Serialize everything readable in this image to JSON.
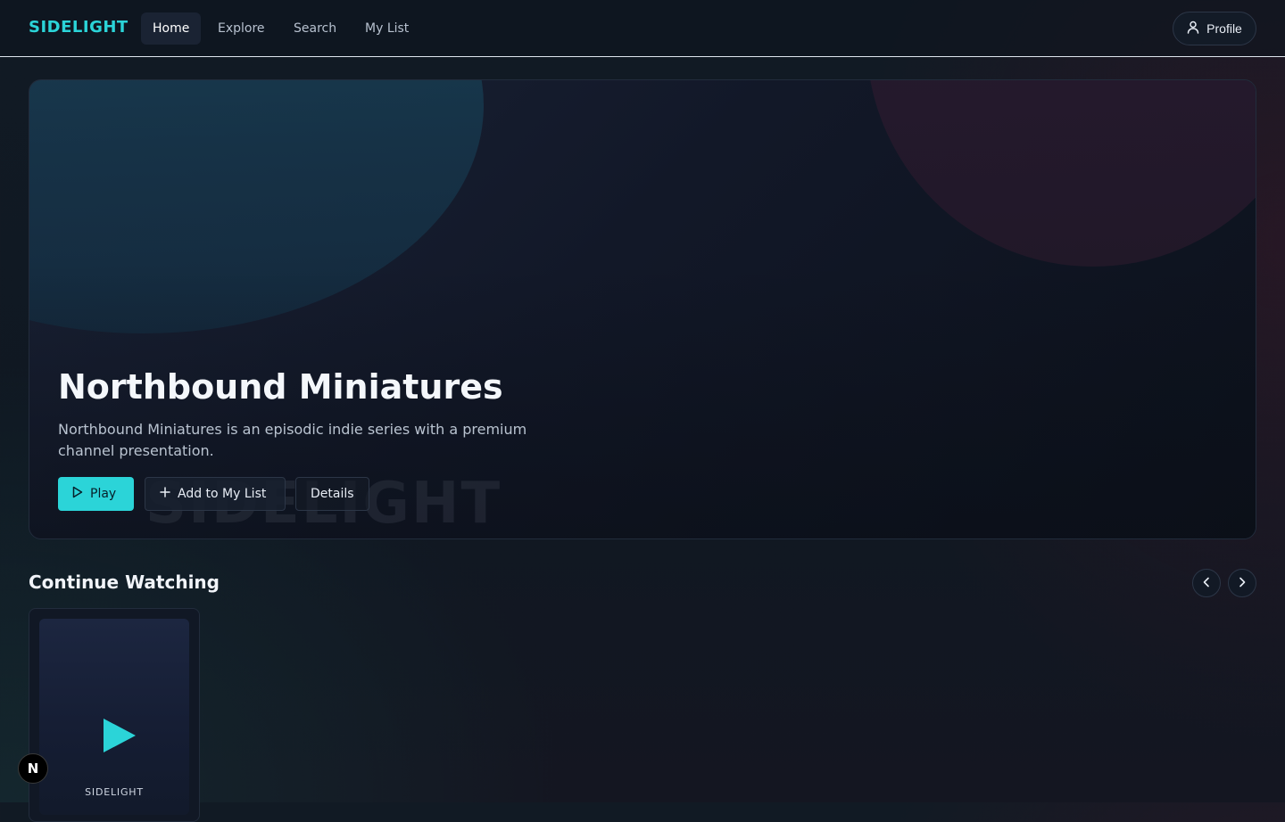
{
  "brand": {
    "name": "SIDELIGHT",
    "accent": "#2bd4d8"
  },
  "nav": {
    "links": [
      {
        "label": "Home",
        "active": true
      },
      {
        "label": "Explore",
        "active": false
      },
      {
        "label": "Search",
        "active": false
      },
      {
        "label": "My List",
        "active": false
      }
    ],
    "profile_label": "Profile",
    "profile_icon": "user-icon"
  },
  "hero": {
    "title": "Northbound Miniatures",
    "description": "Northbound Miniatures is an episodic indie series with a premium channel presentation.",
    "watermark": "SIDELIGHT",
    "buttons": {
      "play": {
        "label": "Play",
        "icon": "play-icon"
      },
      "add": {
        "label": "Add to My List",
        "icon": "plus-icon"
      },
      "details": {
        "label": "Details"
      }
    }
  },
  "continue_watching": {
    "title": "Continue Watching",
    "prev_icon": "chevron-left-icon",
    "next_icon": "chevron-right-icon",
    "items": [
      {
        "label": "SIDELIGHT",
        "icon": "play-icon"
      }
    ]
  },
  "dev_badge": {
    "letter": "N"
  }
}
